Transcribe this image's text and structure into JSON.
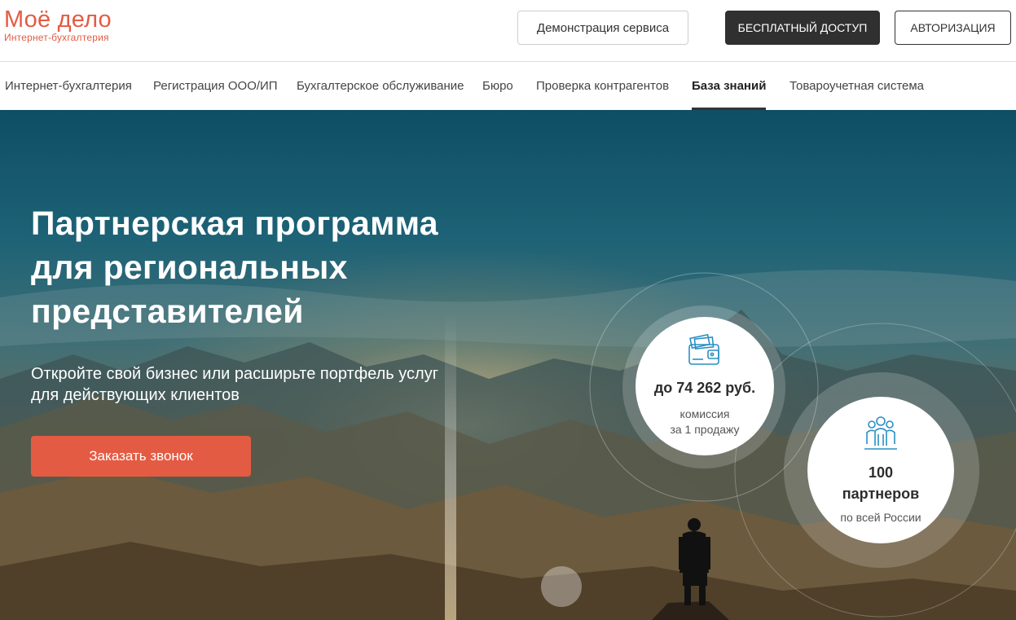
{
  "brand": {
    "name": "Моё дело",
    "tagline": "Интернет-бухгалтерия",
    "color": "#e45b43"
  },
  "header": {
    "demo_label": "Демонстрация сервиса",
    "free_label": "БЕСПЛАТНЫЙ ДОСТУП",
    "auth_label": "АВТОРИЗАЦИЯ"
  },
  "nav": {
    "items": [
      {
        "label": "Интернет-бухгалтерия"
      },
      {
        "label": "Регистрация ООО/ИП"
      },
      {
        "label": "Бухгалтерское обслуживание"
      },
      {
        "label": "Бюро"
      },
      {
        "label": "Проверка контрагентов"
      },
      {
        "label": "База знаний",
        "active": true
      },
      {
        "label": "Товароучетная система"
      }
    ]
  },
  "hero": {
    "title_lines": [
      "Партнерская программа",
      "для региональных",
      "представителей"
    ],
    "subtitle_lines": [
      "Откройте свой бизнес или расширьте портфель услуг",
      "для действующих клиентов"
    ],
    "cta_label": "Заказать звонок",
    "stats": [
      {
        "icon": "wallet-icon",
        "value": "до 74 262 руб.",
        "caption_lines": [
          "комиссия",
          "за 1 продажу"
        ]
      },
      {
        "icon": "people-group-icon",
        "value_lines": [
          "100",
          "партнеров"
        ],
        "caption_lines": [
          "по всей России"
        ]
      }
    ]
  },
  "colors": {
    "accent": "#e45b43",
    "dark_button": "#303030",
    "icon_blue": "#2a8fc4"
  }
}
